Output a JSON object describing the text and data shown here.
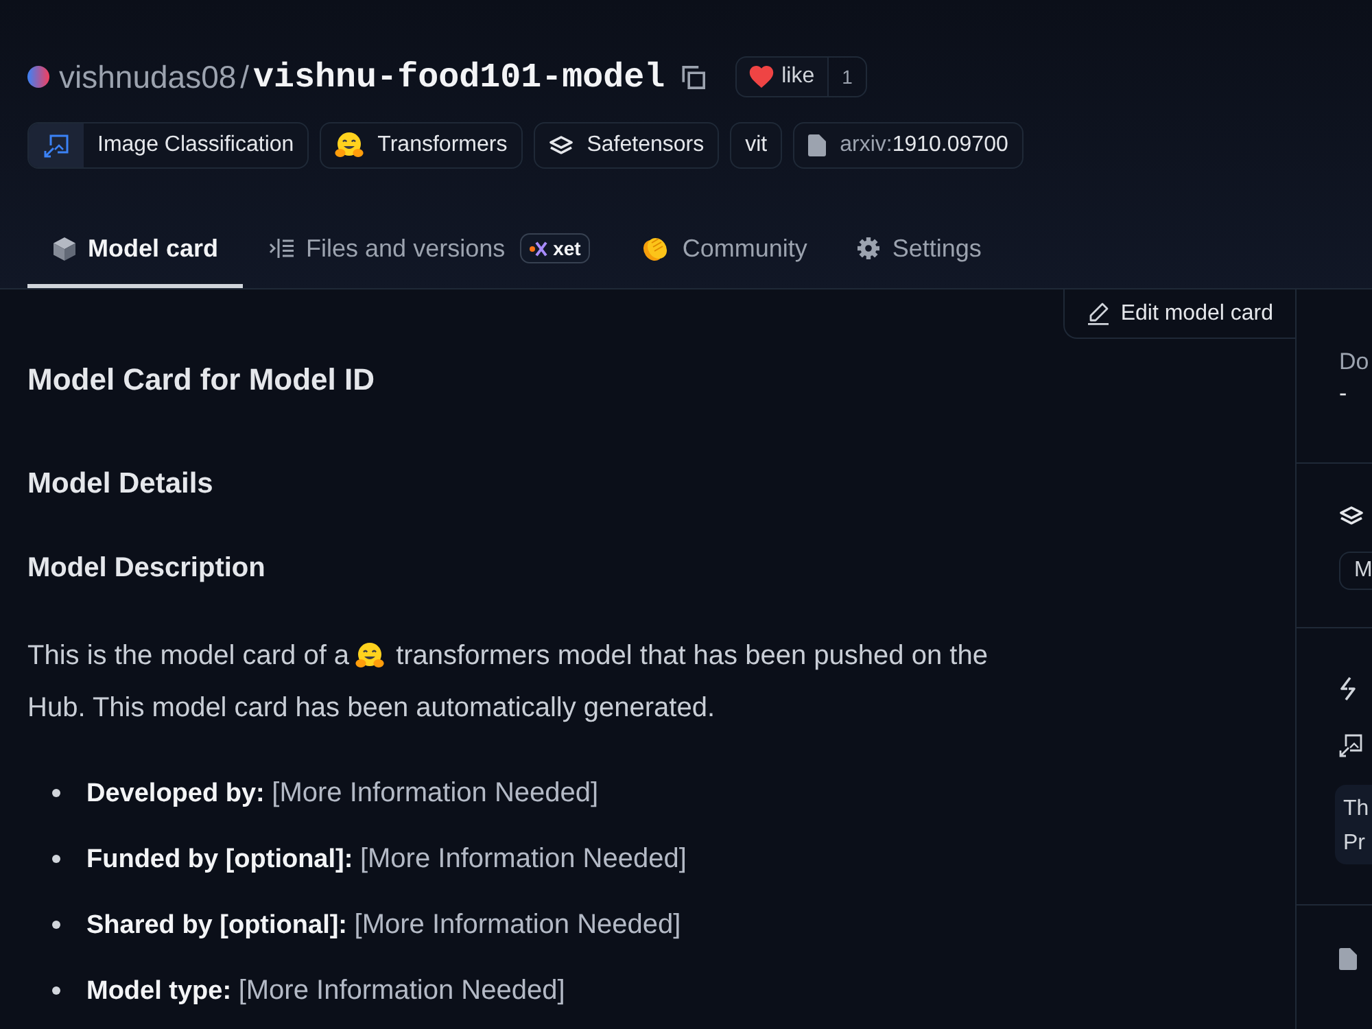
{
  "header": {
    "owner": "vishnudas08",
    "separator": "/",
    "model_name": "vishnu-food101-model",
    "like": {
      "label": "like",
      "count": "1"
    }
  },
  "tags": [
    {
      "kind": "task",
      "label": "Image Classification"
    },
    {
      "kind": "library",
      "label": "Transformers"
    },
    {
      "kind": "format",
      "label": "Safetensors"
    },
    {
      "kind": "plain",
      "label": "vit"
    },
    {
      "kind": "paper",
      "prefix": "arxiv:",
      "label": "1910.09700"
    }
  ],
  "tabs": [
    {
      "kind": "card",
      "label": "Model card",
      "selected": true
    },
    {
      "kind": "files",
      "label": "Files and versions",
      "badge": "xet",
      "selected": false
    },
    {
      "kind": "community",
      "label": "Community",
      "selected": false
    },
    {
      "kind": "settings",
      "label": "Settings",
      "selected": false
    }
  ],
  "edit_button": "Edit model card",
  "card": {
    "title": "Model Card for Model ID",
    "section": "Model Details",
    "subsection": "Model Description",
    "paragraph": [
      "This is the model card of a",
      "transformers model that has been pushed on the Hub. This model card has been automatically generated."
    ],
    "details": [
      {
        "label": "Developed by:",
        "value": "[More Information Needed]"
      },
      {
        "label": "Funded by [optional]:",
        "value": "[More Information Needed]"
      },
      {
        "label": "Shared by [optional]:",
        "value": "[More Information Needed]"
      },
      {
        "label": "Model type:",
        "value": "[More Information Needed]"
      }
    ]
  },
  "sidebar": {
    "downloads_label": "Do",
    "downloads_value": "-",
    "chip": "M",
    "snippet": [
      "Th",
      "Pr"
    ]
  }
}
